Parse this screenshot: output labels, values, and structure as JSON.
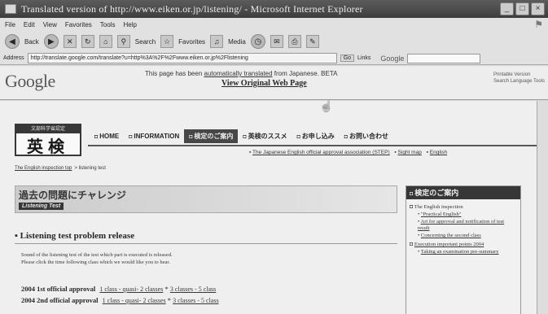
{
  "window": {
    "title": "Translated version of http://www.eiken.or.jp/listening/ - Microsoft Internet Explorer",
    "controls": [
      "_",
      "□",
      "×"
    ]
  },
  "menu": [
    "File",
    "Edit",
    "View",
    "Favorites",
    "Tools",
    "Help"
  ],
  "toolbar": {
    "back_label": "Back",
    "search_label": "Search",
    "favorites_label": "Favorites",
    "media_label": "Media"
  },
  "address": {
    "label": "Address",
    "url": "http://translate.google.com/translate?u=http%3A%2F%2Fwww.eiken.or.jp%2Flistening",
    "go_label": "Go",
    "links_label": "Links",
    "google_label": "Google"
  },
  "google_frame": {
    "logo": "Google",
    "notice_prefix": "This page has been",
    "notice_link": "automatically translated",
    "notice_suffix": "from Japanese. BETA",
    "view_original": "View Original Web Page",
    "options": [
      "Printable Version",
      "Search Language Tools"
    ]
  },
  "site": {
    "logo_small": "文部科学省認定",
    "logo_big": "英検",
    "nav": [
      {
        "label": "HOME",
        "active": false
      },
      {
        "label": "INFORMATION",
        "active": false
      },
      {
        "label": "検定のご案内",
        "active": true
      },
      {
        "label": "英検のススメ",
        "active": false
      },
      {
        "label": "お申し込み",
        "active": false
      },
      {
        "label": "お問い合わせ",
        "active": false
      }
    ],
    "subnav": [
      "The Japanese English official approval association (STEP)",
      "Sight map",
      "English"
    ],
    "breadcrumb": [
      "The English inspection top",
      "listening test"
    ],
    "banner_jp": "過去の問題にチャレンジ",
    "banner_sub": "Listening Test",
    "section_title": "Listening test problem release",
    "intro": [
      "Sound of the listening test of the test which part is executed is released.",
      "Please click the time following class which we would like you to hear."
    ],
    "rows": [
      {
        "label": "2004 1st official approval",
        "links": "1 class - quasi- 2 classes",
        "extra": "3 classes - 5 class"
      },
      {
        "label": "2004 2nd official approval",
        "links": "1 class - quasi- 2 classes",
        "extra": "3 classes - 5 class"
      }
    ]
  },
  "sidebar": {
    "title": "検定のご案内",
    "items": [
      {
        "head": "The English inspection",
        "subs": [
          "\"Practical English\"",
          "Art for approval and notification of test result",
          "Concerning the second class"
        ]
      },
      {
        "head": "Execution important points 2004",
        "subs": [
          "Taking an examination pre-summary"
        ]
      }
    ]
  }
}
